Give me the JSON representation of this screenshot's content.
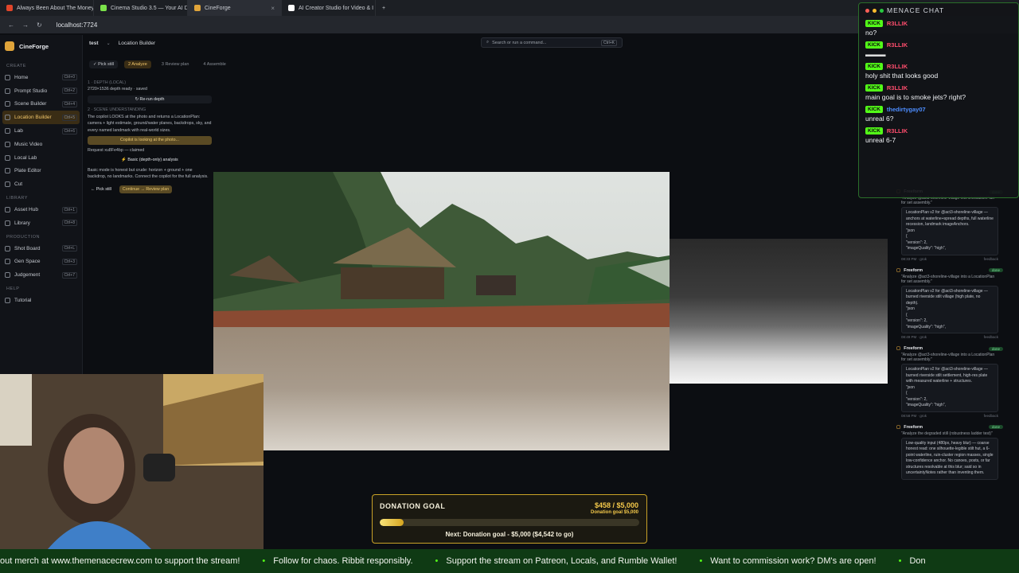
{
  "browser": {
    "tabs": [
      {
        "label": "Always Been About The Money",
        "color": "#e0452a",
        "active": false
      },
      {
        "label": "Cinema Studio 3.5 — Your AI D",
        "color": "#7be34a",
        "active": false
      },
      {
        "label": "CineForge",
        "color": "#e0a43a",
        "active": true
      },
      {
        "label": "AI Creator Studio for Video & I",
        "color": "#ffffff",
        "active": false
      }
    ],
    "url": "localhost:7724"
  },
  "app": {
    "brand": "CineForge",
    "workspace": "test",
    "page": "Location Builder",
    "command_placeholder": "Search or run a command...",
    "command_kbd": "Ctrl+K",
    "sections": [
      {
        "title": "CREATE",
        "items": [
          {
            "label": "Home",
            "kbd": "Ctrl+0",
            "active": false
          },
          {
            "label": "Prompt Studio",
            "kbd": "Ctrl+2",
            "active": false
          },
          {
            "label": "Scene Builder",
            "kbd": "Ctrl+4",
            "active": false
          },
          {
            "label": "Location Builder",
            "kbd": "Ctrl+5",
            "active": true
          },
          {
            "label": "Lab",
            "kbd": "Ctrl+6",
            "active": false
          },
          {
            "label": "Music Video",
            "kbd": "",
            "active": false
          },
          {
            "label": "Local Lab",
            "kbd": "",
            "active": false
          },
          {
            "label": "Plate Editor",
            "kbd": "",
            "active": false
          },
          {
            "label": "Cut",
            "kbd": "",
            "active": false
          }
        ]
      },
      {
        "title": "LIBRARY",
        "items": [
          {
            "label": "Asset Hub",
            "kbd": "Ctrl+1",
            "active": false
          },
          {
            "label": "Library",
            "kbd": "Ctrl+8",
            "active": false
          }
        ]
      },
      {
        "title": "PRODUCTION",
        "items": [
          {
            "label": "Shot Board",
            "kbd": "Ctrl+L",
            "active": false
          },
          {
            "label": "Gen Space",
            "kbd": "Ctrl+3",
            "active": false
          },
          {
            "label": "Judgement",
            "kbd": "Ctrl+7",
            "active": false
          }
        ]
      },
      {
        "title": "HELP",
        "items": [
          {
            "label": "Tutorial",
            "kbd": "",
            "active": false
          }
        ]
      }
    ],
    "steps": [
      {
        "label": "✓ Pick still",
        "state": "done"
      },
      {
        "label": "2 Analyze",
        "state": "cur"
      },
      {
        "label": "3 Review plan",
        "state": "todo"
      },
      {
        "label": "4 Assemble",
        "state": "todo"
      }
    ],
    "panel": {
      "depth_head": "1 · DEPTH (LOCAL)",
      "depth_status": "2720×1536 depth ready · saved",
      "rerun": "Re-run depth",
      "scene_head": "2 · SCENE UNDERSTANDING",
      "scene_desc": "The copilot LOOKS at the photo and returns a LocationPlan: camera + light estimate, ground/water planes, backdrops, sky, and every named landmark with real-world sizes.",
      "busy": "Copilot is looking at the photo...",
      "request": "Request xu8Fe4bp — claimed",
      "basic": "Basic (depth-only) analysis",
      "basic_desc": "Basic mode is honest but crude: horizon + ground + one backdrop, no landmarks. Connect the copilot for the full analysis.",
      "back": "← Pick still",
      "continue": "Continue → Review plan"
    }
  },
  "cards": [
    {
      "title": "Freeform",
      "status": "done",
      "query": "\"Analyze @act3-shoreline-village into a LocationPlan for set assembly.\"",
      "body": "LocationPlan v2 for @act3-shoreline-village — anchors at waterline+spread depths, full waterline recession, landmark imageAnchors.\n\"json\n{\n\"version\": 2,\n\"imageQuality\": \"high\",",
      "time": "08:33 PM · grok",
      "link": "feedback"
    },
    {
      "title": "Freeform",
      "status": "done",
      "query": "\"Analyze @act3-shoreline-village into a LocationPlan for set assembly.\"",
      "body": "LocationPlan v2 for @act3-shoreline-village — burned riverside stilt village (high plate, no depth).\n\"json\n{\n\"version\": 2,\n\"imageQuality\": \"high\",",
      "time": "08:49 PM · grok",
      "link": "feedback"
    },
    {
      "title": "Freeform",
      "status": "done",
      "query": "\"Analyze @act3-shoreline-village into a LocationPlan for set assembly.\"",
      "body": "LocationPlan v2 for @act3-shoreline-village — burned riverside stilt settlement, high-res plate with measured waterline + structures.\n\"json\n{\n\"version\": 2,\n\"imageQuality\": \"high\",",
      "time": "08:58 PM · grok",
      "link": "feedback"
    },
    {
      "title": "Freeform",
      "status": "done",
      "query": "\"Analyze the degraded still (robustness ladder test)\"",
      "body": "Low-quality input (480px, heavy blur) — coarse honest read: one silhouette-legible stilt hut, a 6-point waterline, ruin-cluster region masses, single low-confidence anchor. No canoes, posts, or far structures resolvable at this blur; said so in uncertaintyNotes rather than inventing them.",
      "time": "",
      "link": ""
    }
  ],
  "chat": {
    "title": "MENACE CHAT",
    "platform": "KICK",
    "messages": [
      {
        "user": "R3LLIK",
        "color": "#ff4d6d",
        "text": "no?"
      },
      {
        "user": "R3LLIK",
        "color": "#ff4d6d",
        "text": ""
      },
      {
        "user": "R3LLIK",
        "color": "#ff4d6d",
        "text": "holy shit that looks good"
      },
      {
        "user": "R3LLIK",
        "color": "#ff4d6d",
        "text": "main goal is to smoke jets? right?"
      },
      {
        "user": "thedirtygay07",
        "color": "#4d8dff",
        "text": "unreal 6?"
      },
      {
        "user": "R3LLIK",
        "color": "#ff4d6d",
        "text": "unreal 6-7"
      }
    ]
  },
  "donation": {
    "title": "DONATION GOAL",
    "amount": "$458 / $5,000",
    "sub": "Donation goal $5,000",
    "progress": 0.092,
    "next": "Next: Donation goal - $5,000 ($4,542 to go)"
  },
  "ticker": [
    "out merch at www.themenacecrew.com to support the stream!",
    "Follow for chaos. Ribbit responsibly.",
    "Support the stream on Patreon, Locals, and Rumble Wallet!",
    "Want to commission work? DM's are open!",
    "Don"
  ]
}
